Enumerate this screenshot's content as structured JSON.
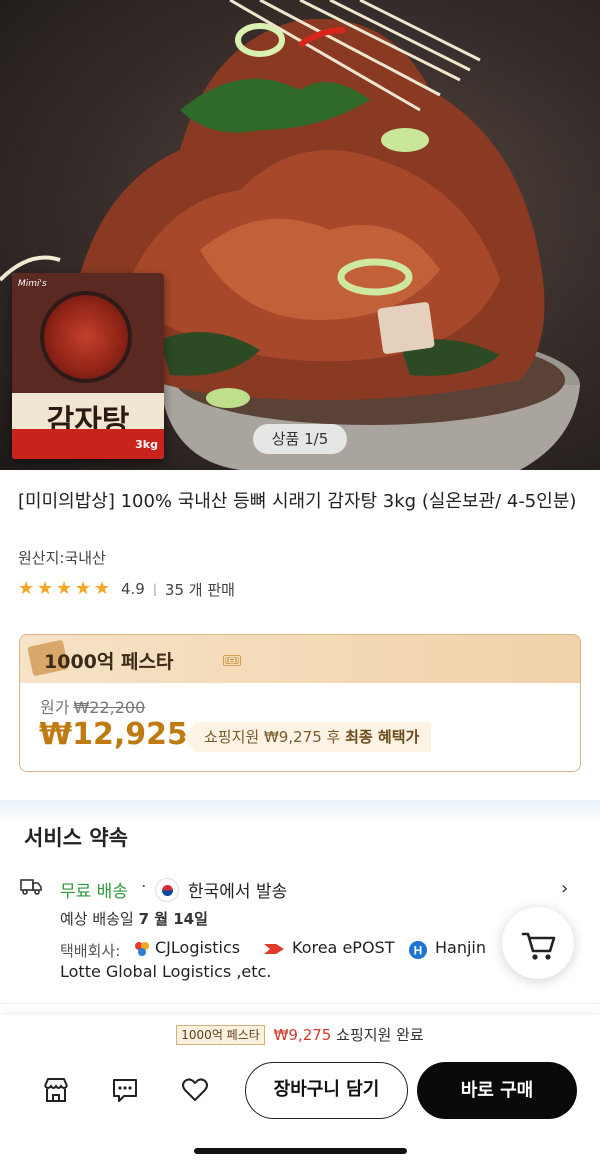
{
  "gallery": {
    "counter": "상품 1/5"
  },
  "package": {
    "brand": "Mimi's",
    "name": "감자탕",
    "weight": "3kg"
  },
  "product": {
    "title": "[미미의밥상] 100% 국내산 등뼈 시래기 감자탕 3kg (실온보관/ 4-5인분)",
    "origin": "원산지:국내산",
    "rating": "4.9",
    "rating_stars": 5,
    "sales": "35 개 판매"
  },
  "festa": {
    "title": "1000억 페스타",
    "original_label": "원가",
    "original_price": "₩22,200",
    "price": "₩12,925",
    "benefit_prefix": "쇼핑지원 ₩9,275 후",
    "benefit_suffix": "최종 혜택가"
  },
  "service": {
    "title": "서비스 약속",
    "free_shipping": "무료 배송",
    "dot": "·",
    "ship_from": "한국에서 발송",
    "eta_prefix": "예상 배송일",
    "eta_date": "7 월 14일",
    "couriers_label": "택배회사:",
    "courier_1": "CJLogistics",
    "courier_2": "Korea ePOST",
    "courier_3": "Hanjin",
    "courier_more": "Lotte Global Logistics ,etc."
  },
  "bottom": {
    "notice_tag": "1000억 페스타",
    "notice_amount": "₩9,275",
    "notice_text": "쇼핑지원 완료",
    "cart_button": "장바구니 담기",
    "buy_button": "바로 구매"
  },
  "colors": {
    "price": "#bf7a12",
    "free_shipping": "#2d9a3e",
    "buy_button": "#0a0a0a",
    "star": "#f5a623"
  }
}
